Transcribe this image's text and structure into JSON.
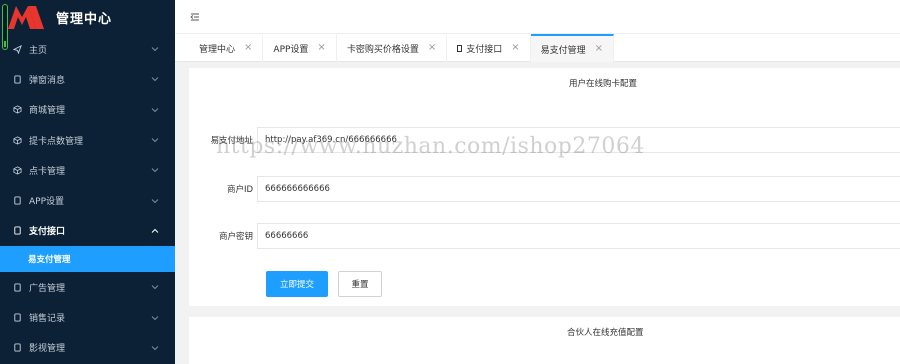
{
  "app": {
    "title": "管理中心"
  },
  "sidebar": {
    "items": [
      {
        "label": "主页",
        "icon": "send-icon"
      },
      {
        "label": "弹窗消息",
        "icon": "tablet-icon"
      },
      {
        "label": "商城管理",
        "icon": "box-icon"
      },
      {
        "label": "提卡点数管理",
        "icon": "box-icon"
      },
      {
        "label": "点卡管理",
        "icon": "box-icon"
      },
      {
        "label": "APP设置",
        "icon": "tablet-icon"
      },
      {
        "label": "支付接口",
        "icon": "tablet-icon",
        "open": true
      },
      {
        "label": "广告管理",
        "icon": "tablet-icon"
      },
      {
        "label": "销售记录",
        "icon": "tablet-icon"
      },
      {
        "label": "影视管理",
        "icon": "tablet-icon"
      }
    ],
    "sub_item": "易支付管理"
  },
  "tabs": [
    {
      "label": "管理中心"
    },
    {
      "label": "APP设置"
    },
    {
      "label": "卡密购买价格设置"
    },
    {
      "label": "支付接口"
    },
    {
      "label": "易支付管理",
      "active": true
    }
  ],
  "form": {
    "section_title": "用户在线购卡配置",
    "fields": [
      {
        "label": "易支付地址",
        "value": "http://pay.af369.cn/666666666"
      },
      {
        "label": "商户ID",
        "value": "666666666666"
      },
      {
        "label": "商户密钥",
        "value": "66666666"
      }
    ],
    "submit_label": "立即提交",
    "reset_label": "重置"
  },
  "second_section_title": "合伙人在线充值配置",
  "watermark": "https://www.huzhan.com/ishop27064",
  "colors": {
    "sidebar_bg": "#0c2136",
    "accent": "#1e9fff",
    "logo_red": "#e8362f"
  }
}
